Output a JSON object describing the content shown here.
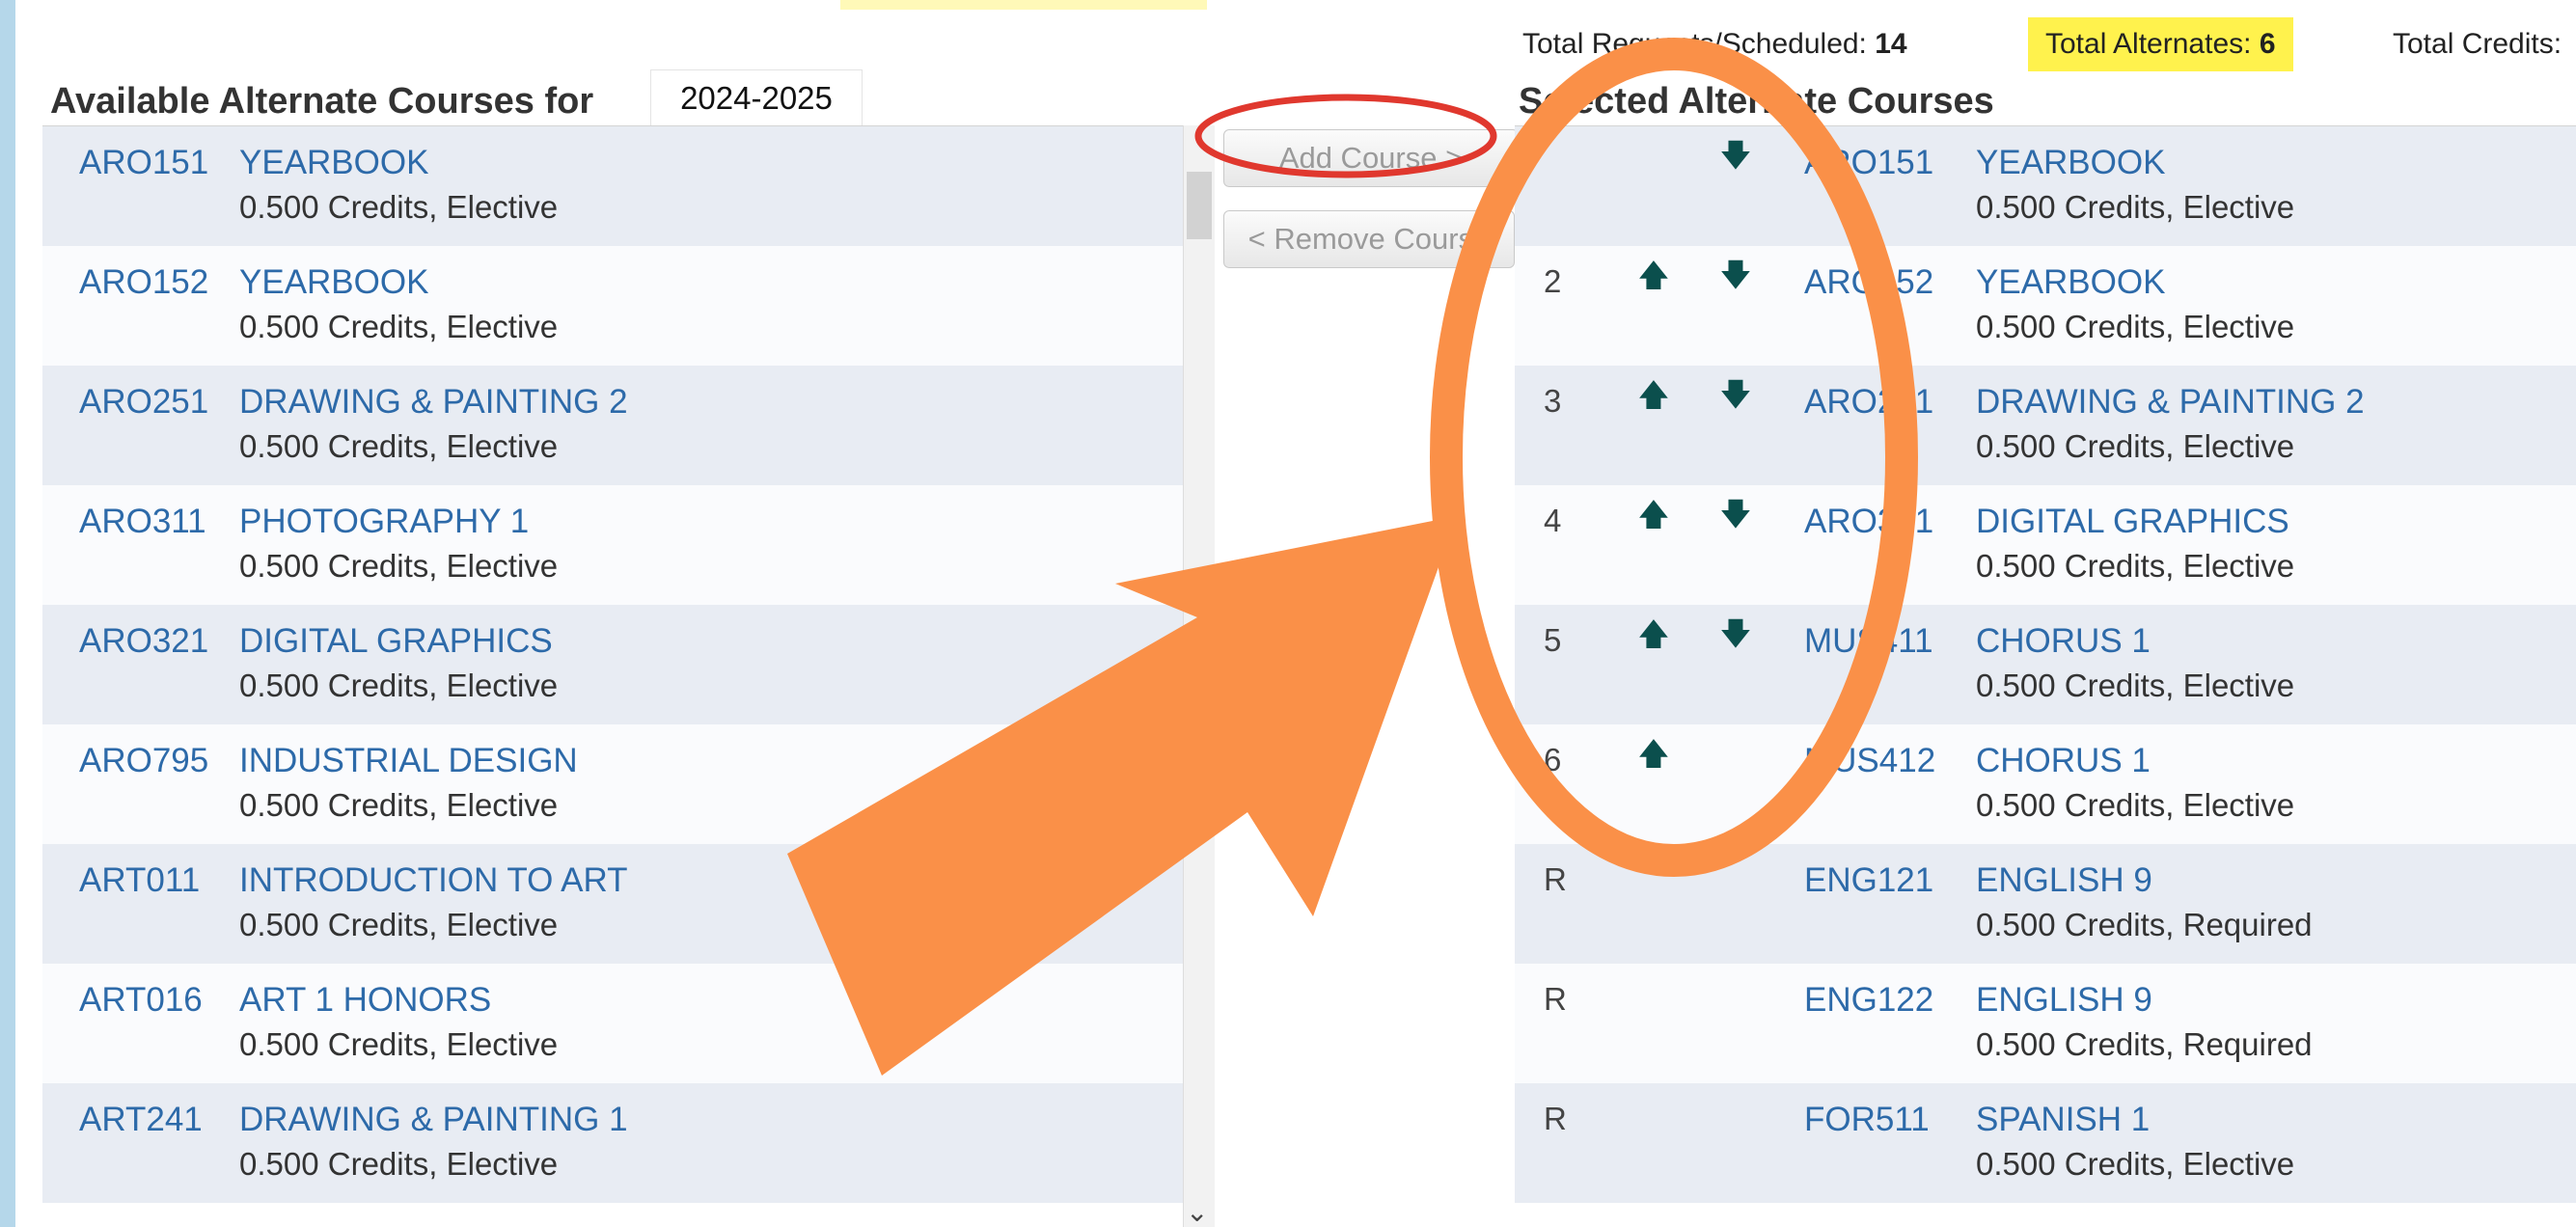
{
  "header": {
    "left_title": "Available Alternate Courses for",
    "year": "2024-2025",
    "right_title": "Selected Alternate Courses",
    "totals": {
      "requests_label": "Total Requests/Scheduled:",
      "requests_value": "14",
      "alternates_label": "Total Alternates:",
      "alternates_value": "6",
      "credits_label": "Total Credits:"
    }
  },
  "buttons": {
    "add": "Add Course >",
    "remove": "< Remove Course"
  },
  "available": [
    {
      "code": "ARO151",
      "name": "YEARBOOK",
      "meta": "0.500 Credits,  Elective"
    },
    {
      "code": "ARO152",
      "name": "YEARBOOK",
      "meta": "0.500 Credits,  Elective"
    },
    {
      "code": "ARO251",
      "name": "DRAWING & PAINTING 2",
      "meta": "0.500 Credits,  Elective"
    },
    {
      "code": "ARO311",
      "name": "PHOTOGRAPHY 1",
      "meta": "0.500 Credits,  Elective"
    },
    {
      "code": "ARO321",
      "name": "DIGITAL GRAPHICS",
      "meta": "0.500 Credits,  Elective"
    },
    {
      "code": "ARO795",
      "name": "INDUSTRIAL DESIGN",
      "meta": "0.500 Credits,  Elective"
    },
    {
      "code": "ART011",
      "name": "INTRODUCTION TO ART",
      "meta": "0.500 Credits,  Elective"
    },
    {
      "code": "ART016",
      "name": "ART 1 HONORS",
      "meta": "0.500 Credits,  Elective"
    },
    {
      "code": "ART241",
      "name": "DRAWING & PAINTING 1",
      "meta": "0.500 Credits,  Elective"
    }
  ],
  "selected": [
    {
      "rank": "",
      "code": "ARO151",
      "name": "YEARBOOK",
      "meta": "0.500 Credits,  Elective",
      "up": false,
      "down": true
    },
    {
      "rank": "2",
      "code": "ARO152",
      "name": "YEARBOOK",
      "meta": "0.500 Credits,  Elective",
      "up": true,
      "down": true
    },
    {
      "rank": "3",
      "code": "ARO251",
      "name": "DRAWING & PAINTING 2",
      "meta": "0.500 Credits,  Elective",
      "up": true,
      "down": true
    },
    {
      "rank": "4",
      "code": "ARO321",
      "name": "DIGITAL GRAPHICS",
      "meta": "0.500 Credits,  Elective",
      "up": true,
      "down": true
    },
    {
      "rank": "5",
      "code": "MUS411",
      "name": "CHORUS 1",
      "meta": "0.500 Credits,  Elective",
      "up": true,
      "down": true
    },
    {
      "rank": "6",
      "code": "MUS412",
      "name": "CHORUS 1",
      "meta": "0.500 Credits,  Elective",
      "up": true,
      "down": false
    },
    {
      "rank": "R",
      "code": "ENG121",
      "name": "ENGLISH 9",
      "meta": "0.500 Credits,  Required",
      "up": false,
      "down": false
    },
    {
      "rank": "R",
      "code": "ENG122",
      "name": "ENGLISH 9",
      "meta": "0.500 Credits,  Required",
      "up": false,
      "down": false
    },
    {
      "rank": "R",
      "code": "FOR511",
      "name": "SPANISH 1",
      "meta": "0.500 Credits,  Elective",
      "up": false,
      "down": false
    }
  ],
  "icons": {
    "up": "arrow-up-icon",
    "down": "arrow-down-icon",
    "scroll": "chevron-down-icon"
  },
  "colors": {
    "link": "#2d6aa9",
    "arrow": "#0b4f4d",
    "annotation_orange": "#fa9048",
    "annotation_red": "#e0382e",
    "highlight_yellow": "#fff24d"
  }
}
